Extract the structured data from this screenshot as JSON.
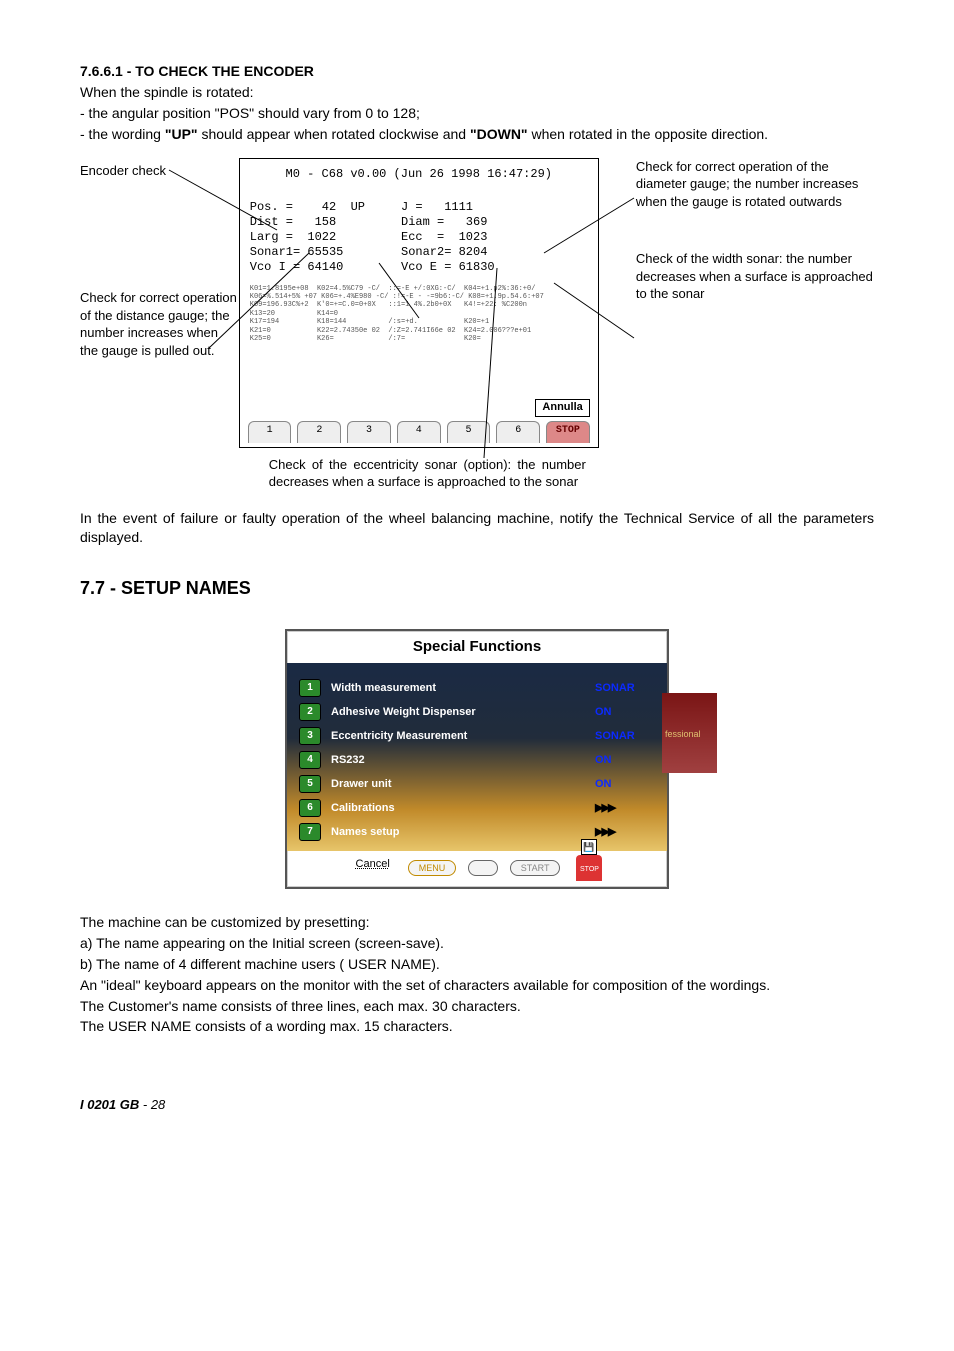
{
  "section1": {
    "heading": "7.6.6.1 - TO CHECK THE ENCODER",
    "line1": "When the spindle is rotated:",
    "line2": "- the angular position \"POS\" should vary from 0 to 128;",
    "line3_a": "- the wording ",
    "line3_b": "\"UP\"",
    "line3_c": " should appear when rotated clockwise and ",
    "line3_d": "\"DOWN\"",
    "line3_e": " when rotated in the opposite direction."
  },
  "labels": {
    "left1": "Encoder check",
    "left2": "Check for correct operation of the distance gauge;           the number          increases when the gauge is  pulled out.",
    "right1": "Check for correct operation of the  diameter gauge; the number  increases  when the gauge is rotated outwards",
    "right2": "Check of the width sonar: the number decreases when a surface is          approached to the sonar",
    "caption": "Check of the eccentricity sonar (option): the number decreases when a surface is approached to the sonar"
  },
  "screen": {
    "header": "M0 - C68  v0.00  (Jun 26 1998 16:47:29)",
    "rows": [
      "Pos. =    42  UP     J =   1111",
      "Dist =   158         Diam =   369",
      "Larg =  1022         Ecc  =  1023",
      "Sonar1= 65535        Sonar2= 8204",
      "Vco I = 64140        Vco E = 61830"
    ],
    "params": "K01=1.8195e+08  K02=4.5%C79 -C/  ::=-E +/:0XG:-C/  K04=+1.p2%:36:+0/\nK06=%.514+5% +07 K06=+.4%E980 -C/ :!=-E - -=9b6:-C/ K08=+1.9p.54.6:+07\nK09=196.93C%+2  K'0=+=C.0=0+0X   ::1=1 4%.2b0+0X   K4!=+22: %C200n\nK13=20          K14=0\nK17=194         K18=144          /:s=+d.           K20=+1\nK21=0           K22=2.74350e 02  /:Z=2.741I66e 02  K24=2.006???e+01\nK25=0           K26=             /:7=              K20=",
    "annulla": "Annulla",
    "tabs": [
      "1",
      "2",
      "3",
      "4",
      "5",
      "6"
    ],
    "tab_stop": "STOP"
  },
  "para2": "In the event of  failure or faulty operation of the wheel balancing machine, notify the Technical Service of all the parameters displayed.",
  "section2_heading": "7.7 - SETUP NAMES",
  "sf": {
    "title": "Special Functions",
    "side": "fessional",
    "items": [
      {
        "n": "1",
        "label": "Width measurement",
        "val": "SONAR"
      },
      {
        "n": "2",
        "label": "Adhesive Weight Dispenser",
        "val": "ON"
      },
      {
        "n": "3",
        "label": "Eccentricity Measurement",
        "val": "SONAR"
      },
      {
        "n": "4",
        "label": "RS232",
        "val": "ON"
      },
      {
        "n": "5",
        "label": "Drawer unit",
        "val": "ON"
      },
      {
        "n": "6",
        "label": "Calibrations",
        "arrows": "▶▶▶"
      },
      {
        "n": "7",
        "label": "Names setup",
        "arrows": "▶▶▶"
      }
    ],
    "cancel": "Cancel",
    "menu": "MENU",
    "start": "START",
    "stop": "STOP",
    "save": "💾"
  },
  "body2": {
    "l1": "The machine can be customized by presetting:",
    "l2": "a) The name appearing on the Initial screen (screen-save).",
    "l3": "b) The name of 4 different machine users ( USER NAME).",
    "l4": "An \"ideal\" keyboard appears on the monitor with the set of characters available for composition of the wordings.",
    "l5": "The Customer's name consists of three lines, each max. 30 characters.",
    "l6": "The USER NAME consists of a wording max. 15 characters."
  },
  "footer": {
    "code": "I 0201 GB",
    "sep": " - ",
    "page": "28"
  }
}
